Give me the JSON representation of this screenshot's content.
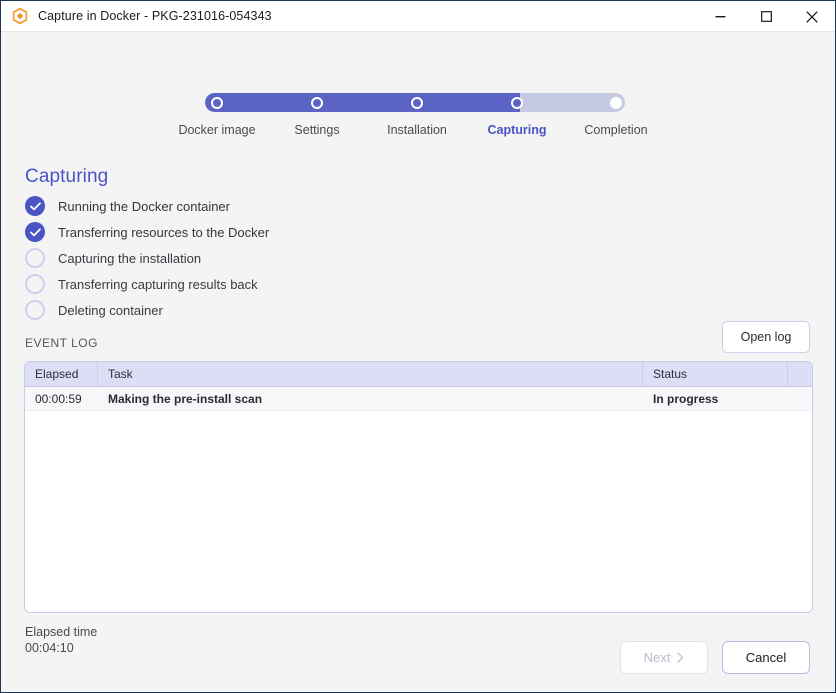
{
  "window": {
    "title": "Capture in Docker - PKG-231016-054343",
    "app_icon": "docker-capture-icon",
    "controls": {
      "minimize": "minimize-icon",
      "maximize": "maximize-icon",
      "close": "close-icon"
    }
  },
  "stepper": {
    "current_index": 3,
    "steps": [
      {
        "label": "Docker image",
        "state": "done"
      },
      {
        "label": "Settings",
        "state": "done"
      },
      {
        "label": "Installation",
        "state": "done"
      },
      {
        "label": "Capturing",
        "state": "current"
      },
      {
        "label": "Completion",
        "state": "todo"
      }
    ],
    "fill_percent": 75,
    "fill_color": "#5b63c4",
    "track_color": "#c6c9e2",
    "current_label_color": "#4a54c4"
  },
  "section": {
    "title": "Capturing",
    "title_color": "#4a54c4",
    "tasks": [
      {
        "label": "Running the Docker container",
        "state": "done"
      },
      {
        "label": "Transferring resources to the Docker",
        "state": "done"
      },
      {
        "label": "Capturing the installation",
        "state": "pending"
      },
      {
        "label": "Transferring capturing results back",
        "state": "pending"
      },
      {
        "label": "Deleting container",
        "state": "pending"
      }
    ]
  },
  "event_log": {
    "label": "EVENT LOG",
    "open_log_label": "Open log",
    "columns": [
      "Elapsed",
      "Task",
      "Status"
    ],
    "rows": [
      {
        "elapsed": "00:00:59",
        "task": "Making the pre-install scan",
        "status": "In progress"
      }
    ]
  },
  "elapsed": {
    "label": "Elapsed time",
    "value": "00:04:10"
  },
  "footer": {
    "next_label": "Next",
    "next_icon": "chevron-right-icon",
    "next_disabled": true,
    "cancel_label": "Cancel"
  }
}
